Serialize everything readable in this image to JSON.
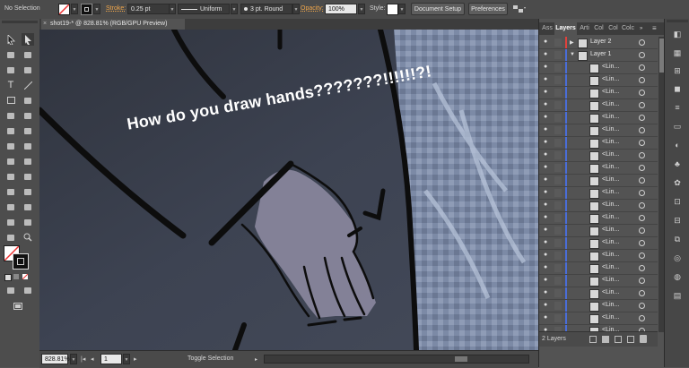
{
  "control_bar": {
    "selection_label": "No Selection",
    "stroke_label": "Stroke:",
    "stroke_weight": "0.25 pt",
    "profile": "Uniform",
    "brush": "3 pt. Round",
    "opacity_label": "Opacity:",
    "opacity_value": "100%",
    "style_label": "Style:",
    "document_setup": "Document Setup",
    "preferences": "Preferences",
    "accent_color": "#f0a64b"
  },
  "document": {
    "tab_title": "shot19-* @ 828.81% (RGB/GPU Preview)",
    "close_glyph": "×"
  },
  "artwork": {
    "caption": "How do you draw hands???????!!!!!!?!"
  },
  "status_bar": {
    "zoom": "828.81%",
    "artboard": "1",
    "toggle_label": "Toggle Selection"
  },
  "layers_panel": {
    "tabs": [
      "Ass",
      "Layers",
      "Arti",
      "Col",
      "Col",
      "Colc"
    ],
    "active_tab": "Layers",
    "layers": [
      {
        "name": "Layer 2",
        "color": "#e0413c"
      },
      {
        "name": "Layer 1",
        "color": "#4a6dd8"
      }
    ],
    "sublayer_label": "<Lin...",
    "footer_count": "2 Layers"
  },
  "icons": {
    "eye": "eye-icon",
    "lock": "lock-icon",
    "target": "target-circle-icon"
  }
}
